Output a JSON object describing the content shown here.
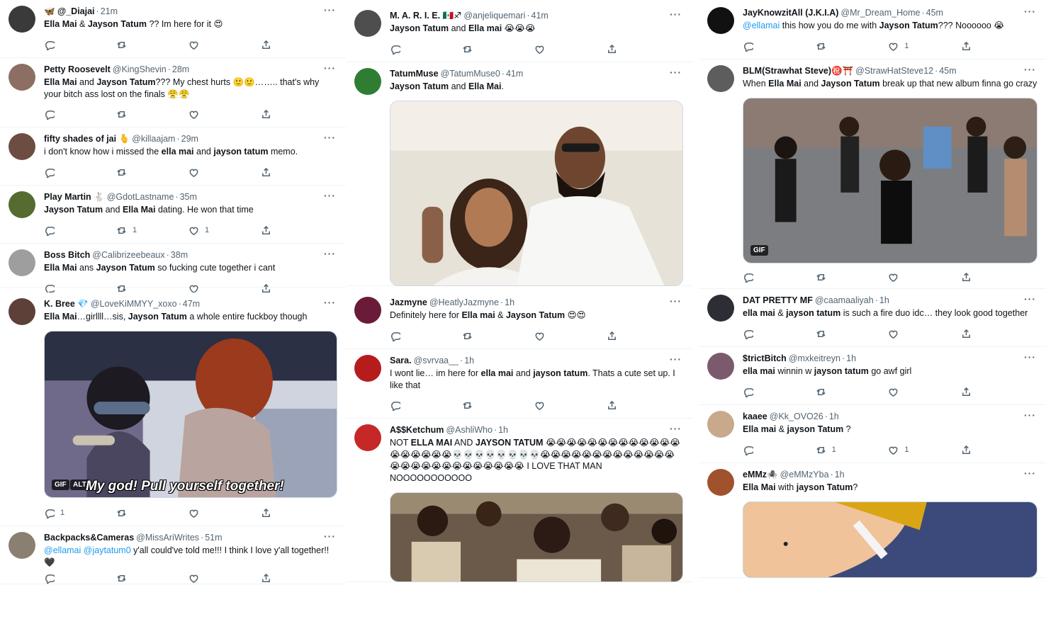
{
  "columns": [
    {
      "tweets": [
        {
          "name": "🦋 @_Diajai",
          "handle": "",
          "time": "21m",
          "parts": [
            [
              "b",
              "Ella Mai"
            ],
            [
              "t",
              " & "
            ],
            [
              "b",
              "Jayson Tatum"
            ],
            [
              "t",
              " ?? Im here for it 😍"
            ]
          ]
        },
        {
          "name": "Petty Roosevelt",
          "handle": "@KingShevin",
          "time": "28m",
          "parts": [
            [
              "b",
              "Ella Mai"
            ],
            [
              "t",
              " and "
            ],
            [
              "b",
              "Jayson Tatum"
            ],
            [
              "t",
              "??? My chest hurts 🙂🙂…….. that's why your bitch ass lost on the finals 😤😤"
            ]
          ]
        },
        {
          "name": "fifty shades of jai 🫰",
          "handle": "@killaajam",
          "time": "29m",
          "parts": [
            [
              "t",
              "i don't know how i missed the "
            ],
            [
              "b",
              "ella mai"
            ],
            [
              "t",
              " and "
            ],
            [
              "b",
              "jayson tatum"
            ],
            [
              "t",
              " memo."
            ]
          ]
        },
        {
          "name": "Play Martin 🐇",
          "handle": "@GdotLastname",
          "time": "35m",
          "retweets": "1",
          "likes": "1",
          "parts": [
            [
              "b",
              "Jayson Tatum"
            ],
            [
              "t",
              " and "
            ],
            [
              "b",
              "Ella Mai"
            ],
            [
              "t",
              " dating. He won that time"
            ]
          ]
        },
        {
          "name": "Boss Bitch",
          "handle": "@Calibrizeebeaux",
          "time": "38m",
          "parts": [
            [
              "b",
              "Ella Mai"
            ],
            [
              "t",
              " ans "
            ],
            [
              "b",
              "Jayson Tatum"
            ],
            [
              "t",
              " so fucking cute together i cant"
            ]
          ]
        },
        {
          "name": "K. Bree 💎",
          "handle": "@LoveKiMMYY_xoxo",
          "time": "47m",
          "replies": "1",
          "gif": "GIF",
          "alt": "ALT",
          "caption": "My god! Pull yourself together!",
          "parts": [
            [
              "b",
              "Ella Mai"
            ],
            [
              "t",
              "…girllll…sis, "
            ],
            [
              "b",
              "Jayson Tatum"
            ],
            [
              "t",
              " a whole entire fuckboy though"
            ]
          ]
        },
        {
          "name": "Backpacks&Cameras",
          "handle": "@MissAriWrites",
          "time": "51m",
          "parts": [
            [
              "m",
              "@ellamai"
            ],
            [
              "t",
              " "
            ],
            [
              "m",
              "@jaytatum0"
            ],
            [
              "t",
              " y'all could've told me!!! I think I love y'all together!! 🖤"
            ]
          ]
        }
      ]
    },
    {
      "tweets": [
        {
          "name": "M. A. R. I. E. 🇲🇽♐",
          "handle": "@anjeliquemari",
          "time": "41m",
          "parts": [
            [
              "b",
              "Jayson Tatum"
            ],
            [
              "t",
              " and "
            ],
            [
              "b",
              "Ella mai"
            ],
            [
              "t",
              " 😭😭😭"
            ]
          ]
        },
        {
          "name": "TatumMuse",
          "handle": "@TatumMuse0",
          "time": "41m",
          "parts": [
            [
              "b",
              "Jayson Tatum"
            ],
            [
              "t",
              " and "
            ],
            [
              "b",
              "Ella Mai"
            ],
            [
              "t",
              "."
            ]
          ]
        },
        {
          "name": "Jazmyne",
          "handle": "@HeatlyJazmyne",
          "time": "1h",
          "parts": [
            [
              "t",
              "Definitely here for "
            ],
            [
              "b",
              "Ella mai"
            ],
            [
              "t",
              " & "
            ],
            [
              "b",
              "Jayson Tatum"
            ],
            [
              "t",
              " 😍😍"
            ]
          ]
        },
        {
          "name": "Sara.",
          "handle": "@svrvaa__",
          "time": "1h",
          "parts": [
            [
              "t",
              "I wont lie… im here for "
            ],
            [
              "b",
              "ella mai"
            ],
            [
              "t",
              " and "
            ],
            [
              "b",
              "jayson tatum"
            ],
            [
              "t",
              ". Thats a cute set up. I like that"
            ]
          ]
        },
        {
          "name": "A$$Ketchum",
          "handle": "@AshliWho",
          "time": "1h",
          "parts": [
            [
              "t",
              "NOT "
            ],
            [
              "b",
              "ELLA MAI"
            ],
            [
              "t",
              " AND "
            ],
            [
              "b",
              "JAYSON TATUM"
            ],
            [
              "t",
              " 😭😭😭😭😭😭😭😭😭😭😭😭😭😭😭😭😭😭😭💀💀💀💀💀💀💀💀😭😭😭😭😭😭😭😭😭😭😭😭😭😭😭😭😭😭😭😭😭😭😭😭😭😭 I LOVE THAT MAN NOOOOOOOOOOO"
            ]
          ]
        }
      ]
    },
    {
      "tweets": [
        {
          "name": "JayKnowzitAll (J.K.I.A)",
          "handle": "@Mr_Dream_Home",
          "time": "45m",
          "likes": "1",
          "parts": [
            [
              "m",
              "@ellamai"
            ],
            [
              "t",
              " this how you do me with "
            ],
            [
              "b",
              "Jayson Tatum"
            ],
            [
              "t",
              "??? Noooooo 😭"
            ]
          ]
        },
        {
          "name": "BLM(Strawhat Steve)㊗️⛩️",
          "handle": "@StrawHatSteve12",
          "time": "45m",
          "gif": "GIF",
          "parts": [
            [
              "t",
              "When "
            ],
            [
              "b",
              "Ella Mai"
            ],
            [
              "t",
              " and "
            ],
            [
              "b",
              "Jayson Tatum"
            ],
            [
              "t",
              " break up that new album finna go crazy"
            ]
          ]
        },
        {
          "name": "DAT PRETTY MF",
          "handle": "@caamaaliyah",
          "time": "1h",
          "parts": [
            [
              "b",
              "ella mai"
            ],
            [
              "t",
              " & "
            ],
            [
              "b",
              "jayson tatum"
            ],
            [
              "t",
              " is such a fire duo idc… they look good together"
            ]
          ]
        },
        {
          "name": "$trictBitch",
          "handle": "@mxkeitreyn",
          "time": "1h",
          "parts": [
            [
              "b",
              "ella mai"
            ],
            [
              "t",
              " winnin w "
            ],
            [
              "b",
              "jayson tatum"
            ],
            [
              "t",
              " go awf girl"
            ]
          ]
        },
        {
          "name": "kaaee",
          "handle": "@Kk_OVO26",
          "time": "1h",
          "retweets": "1",
          "likes": "1",
          "parts": [
            [
              "b",
              "Ella mai"
            ],
            [
              "t",
              " & "
            ],
            [
              "b",
              "jayson Tatum"
            ],
            [
              "t",
              " ?"
            ]
          ]
        },
        {
          "name": "eMMz🕷️",
          "handle": "@eMMzYba",
          "time": "1h",
          "parts": [
            [
              "b",
              "Ella Mai"
            ],
            [
              "t",
              " with "
            ],
            [
              "b",
              "jayson Tatum"
            ],
            [
              "t",
              "?"
            ]
          ]
        }
      ]
    }
  ],
  "colors": {
    "link": "#1d9bf0",
    "muted": "#536471",
    "text": "#0f1419",
    "border": "#eff3f4"
  },
  "icons": [
    "reply-icon",
    "retweet-icon",
    "like-icon",
    "share-icon",
    "more-icon"
  ]
}
